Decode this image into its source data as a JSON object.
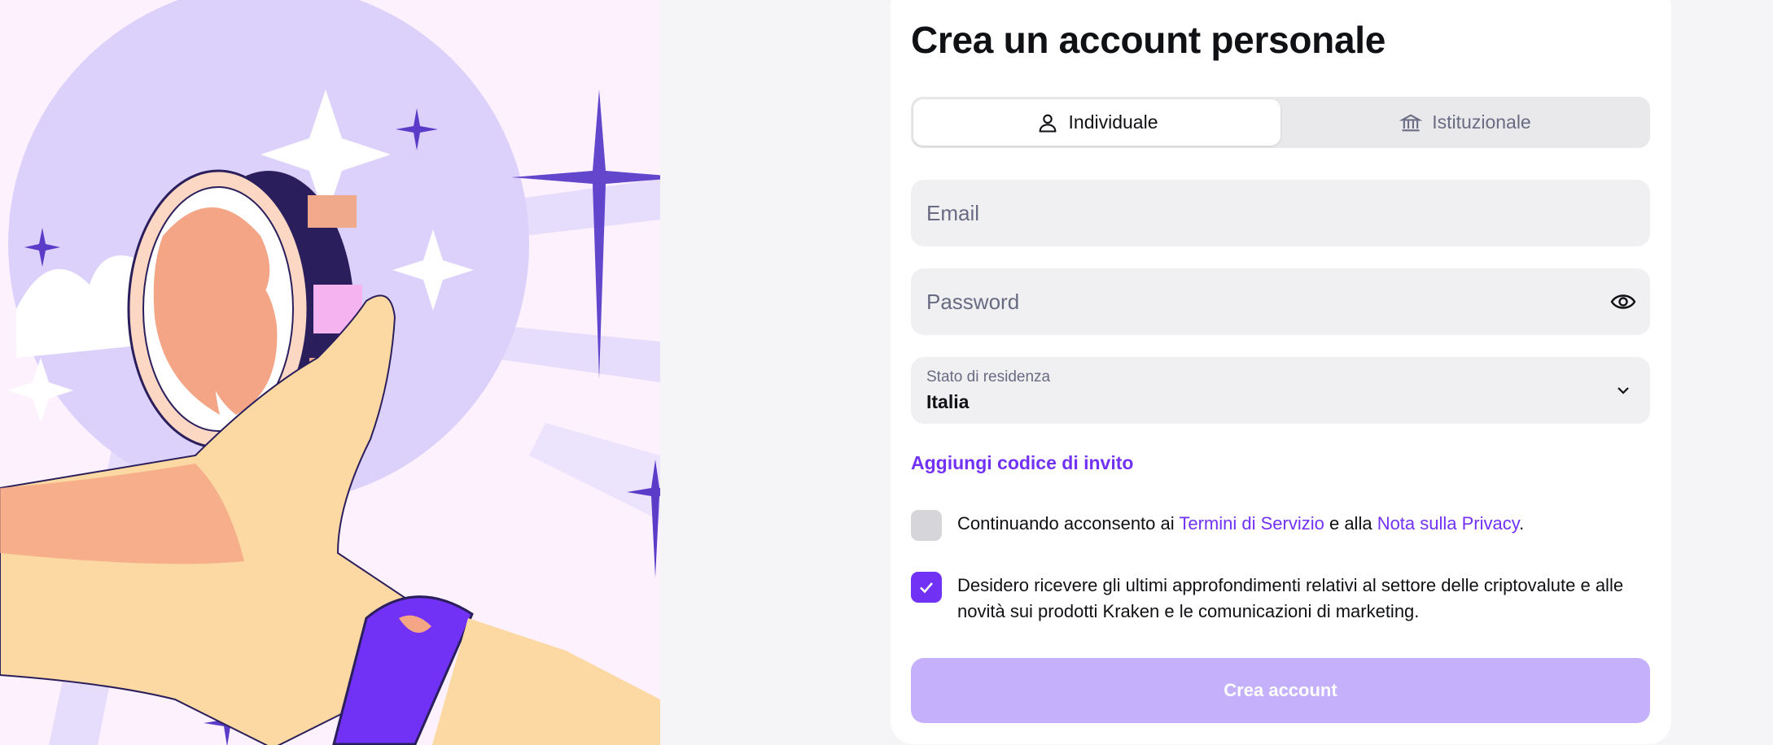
{
  "header": {
    "title": "Crea un account personale"
  },
  "account_type_tabs": [
    {
      "label": "Individuale",
      "icon": "user-icon",
      "active": true
    },
    {
      "label": "Istituzionale",
      "icon": "bank-icon",
      "active": false
    }
  ],
  "form": {
    "email": {
      "placeholder": "Email",
      "value": ""
    },
    "password": {
      "placeholder": "Password",
      "value": "",
      "toggle_icon": "eye-icon"
    },
    "country": {
      "label": "Stato di residenza",
      "value": "Italia",
      "icon": "chevron-down-icon"
    },
    "invite_link": "Aggiungi codice di invito",
    "terms": {
      "checked": false,
      "prefix": "Continuando acconsento ai ",
      "terms_link": "Termini di Servizio",
      "middle": " e alla ",
      "privacy_link": "Nota sulla Privacy",
      "suffix": "."
    },
    "marketing": {
      "checked": true,
      "text": "Desidero ricevere gli ultimi approfondimenti relativi al settore delle criptovalute e alle novità sui prodotti Kraken e le comunicazioni di marketing."
    },
    "submit_label": "Crea account"
  },
  "colors": {
    "accent": "#7132f5",
    "button_disabled": "#c5b1fb",
    "field_bg": "#f0f0f2",
    "illustration_bg": "#fcf1fd",
    "illustration_lavender": "#dcd1fb"
  }
}
